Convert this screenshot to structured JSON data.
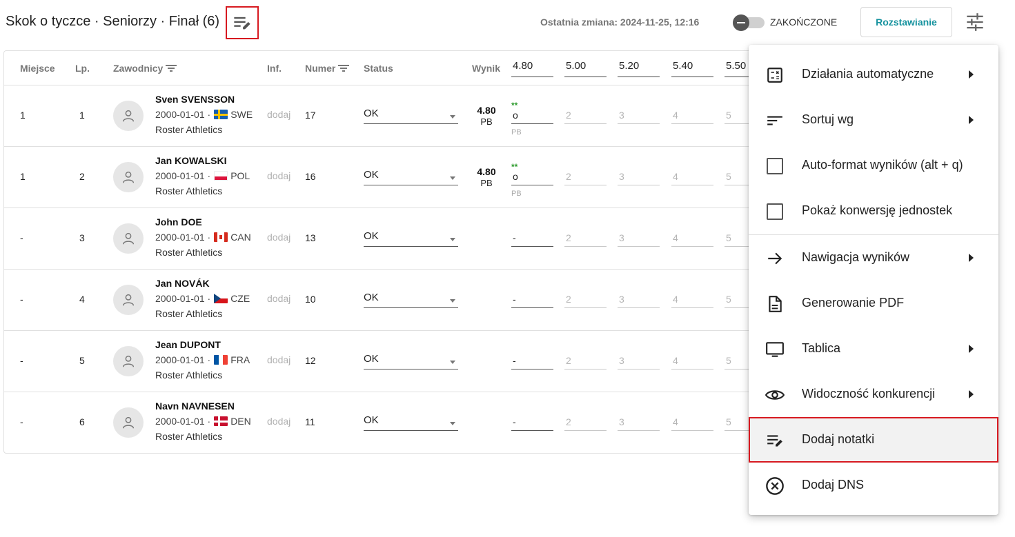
{
  "header": {
    "title": "Skok o tyczce · Seniorzy · Finał (6)",
    "last_change_label": "Ostatnia zmiana: 2024-11-25, 12:16",
    "finished_toggle_label": "ZAKOŃCZONE",
    "finished_toggle_on": false,
    "seeding_button": "Rozstawianie",
    "notes_icon": "edit-notes-icon",
    "settings_icon": "tune-icon"
  },
  "table": {
    "columns": {
      "place": "Miejsce",
      "lp": "Lp.",
      "athletes": "Zawodnicy",
      "inf": "Inf.",
      "number": "Numer",
      "status": "Status",
      "result": "Wynik"
    },
    "heights": [
      "4.80",
      "5.00",
      "5.20",
      "5.40",
      "5.50"
    ],
    "add_label": "dodaj",
    "rows": [
      {
        "place": "1",
        "lp": "1",
        "name": "Sven SVENSSON",
        "dob": "2000-01-01",
        "country": "SWE",
        "club": "Roster Athletics",
        "number": "17",
        "status": "OK",
        "result": "4.80",
        "result_note": "PB",
        "first_attempt": "o",
        "first_attempt_marks": "**",
        "first_attempt_note": "PB",
        "placeholders": [
          "2",
          "3",
          "4",
          "5"
        ]
      },
      {
        "place": "1",
        "lp": "2",
        "name": "Jan KOWALSKI",
        "dob": "2000-01-01",
        "country": "POL",
        "club": "Roster Athletics",
        "number": "16",
        "status": "OK",
        "result": "4.80",
        "result_note": "PB",
        "first_attempt": "o",
        "first_attempt_marks": "**",
        "first_attempt_note": "PB",
        "placeholders": [
          "2",
          "3",
          "4",
          "5"
        ]
      },
      {
        "place": "-",
        "lp": "3",
        "name": "John DOE",
        "dob": "2000-01-01",
        "country": "CAN",
        "club": "Roster Athletics",
        "number": "13",
        "status": "OK",
        "result": "",
        "result_note": "",
        "first_attempt": "-",
        "first_attempt_marks": "",
        "first_attempt_note": "",
        "placeholders": [
          "2",
          "3",
          "4",
          "5"
        ]
      },
      {
        "place": "-",
        "lp": "4",
        "name": "Jan NOVÁK",
        "dob": "2000-01-01",
        "country": "CZE",
        "club": "Roster Athletics",
        "number": "10",
        "status": "OK",
        "result": "",
        "result_note": "",
        "first_attempt": "-",
        "first_attempt_marks": "",
        "first_attempt_note": "",
        "placeholders": [
          "2",
          "3",
          "4",
          "5"
        ]
      },
      {
        "place": "-",
        "lp": "5",
        "name": "Jean DUPONT",
        "dob": "2000-01-01",
        "country": "FRA",
        "club": "Roster Athletics",
        "number": "12",
        "status": "OK",
        "result": "",
        "result_note": "",
        "first_attempt": "-",
        "first_attempt_marks": "",
        "first_attempt_note": "",
        "placeholders": [
          "2",
          "3",
          "4",
          "5"
        ]
      },
      {
        "place": "-",
        "lp": "6",
        "name": "Navn NAVNESEN",
        "dob": "2000-01-01",
        "country": "DEN",
        "club": "Roster Athletics",
        "number": "11",
        "status": "OK",
        "result": "",
        "result_note": "",
        "first_attempt": "-",
        "first_attempt_marks": "",
        "first_attempt_note": "",
        "placeholders": [
          "2",
          "3",
          "4",
          "5"
        ]
      }
    ]
  },
  "menu": {
    "items": [
      {
        "label": "Działania automatyczne",
        "icon": "calculator-icon",
        "submenu": true
      },
      {
        "label": "Sortuj wg",
        "icon": "sort-icon",
        "submenu": true
      },
      {
        "label": "Auto-format wyników (alt + q)",
        "icon": "checkbox-icon",
        "submenu": false
      },
      {
        "label": "Pokaż konwersję jednostek",
        "icon": "checkbox-icon",
        "submenu": false
      },
      {
        "label": "Nawigacja wyników",
        "icon": "arrow-right-icon",
        "submenu": true
      },
      {
        "label": "Generowanie PDF",
        "icon": "document-icon",
        "submenu": false
      },
      {
        "label": "Tablica",
        "icon": "monitor-icon",
        "submenu": true
      },
      {
        "label": "Widoczność konkurencji",
        "icon": "eye-icon",
        "submenu": true
      },
      {
        "label": "Dodaj notatki",
        "icon": "edit-notes-icon",
        "submenu": false,
        "highlighted": true
      },
      {
        "label": "Dodaj DNS",
        "icon": "cancel-circle-icon",
        "submenu": false
      }
    ]
  },
  "colors": {
    "accent": "#17939f",
    "highlight_border": "#d71920",
    "success_mark": "#2e9b2e"
  }
}
